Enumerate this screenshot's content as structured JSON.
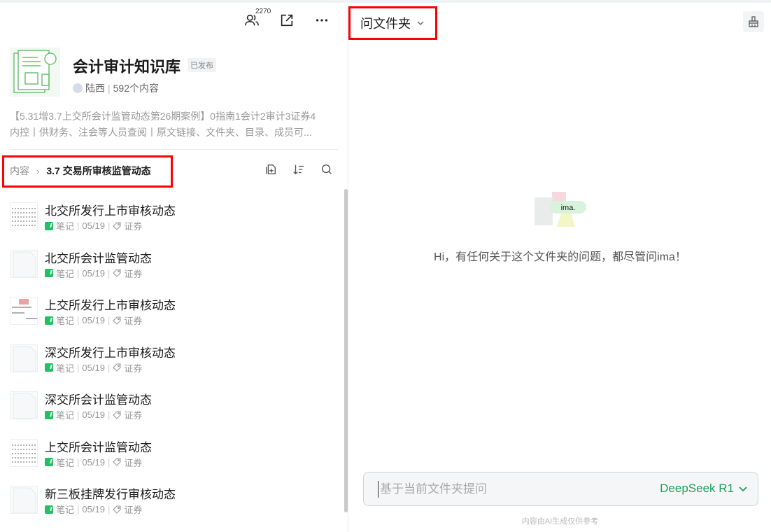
{
  "toolbar": {
    "member_count": "2270",
    "members_icon": "members-icon",
    "share_icon": "share-icon",
    "more_icon": "more-icon"
  },
  "kb": {
    "title": "会计审计知识库",
    "badge": "已发布",
    "author": "陆西",
    "count": "592个内容",
    "desc_line1": "【5.31增3.7上交所会计监管动态第26期案例】0指南1会计2审计3证券4",
    "desc_line2": "内控丨供财务、注会等人员查阅丨原文链接、文件夹、目录、成员可..."
  },
  "breadcrumb": {
    "root": "内容",
    "current": "3.7 交易所审核监管动态"
  },
  "items": [
    {
      "title": "北交所发行上市审核动态",
      "type": "笔记",
      "date": "05/19",
      "tag": "证券"
    },
    {
      "title": "北交所会计监管动态",
      "type": "笔记",
      "date": "05/19",
      "tag": "证券"
    },
    {
      "title": "上交所发行上市审核动态",
      "type": "笔记",
      "date": "05/19",
      "tag": "证券"
    },
    {
      "title": "深交所发行上市审核动态",
      "type": "笔记",
      "date": "05/19",
      "tag": "证券"
    },
    {
      "title": "深交所会计监管动态",
      "type": "笔记",
      "date": "05/19",
      "tag": "证券"
    },
    {
      "title": "上交所会计监管动态",
      "type": "笔记",
      "date": "05/19",
      "tag": "证券"
    },
    {
      "title": "新三板挂牌发行审核动态",
      "type": "笔记",
      "date": "05/19",
      "tag": "证券"
    }
  ],
  "right": {
    "folder_label": "问文件夹",
    "logo_text": "ima.",
    "hint": "Hi，有任何关于这个文件夹的问题，都尽管问ima！",
    "input_placeholder": "基于当前文件夹提问",
    "model": "DeepSeek R1",
    "disclaimer": "内容由AI生成仅供参考"
  },
  "colors": {
    "accent_green": "#1aa25c",
    "highlight_red": "#ff0000"
  }
}
